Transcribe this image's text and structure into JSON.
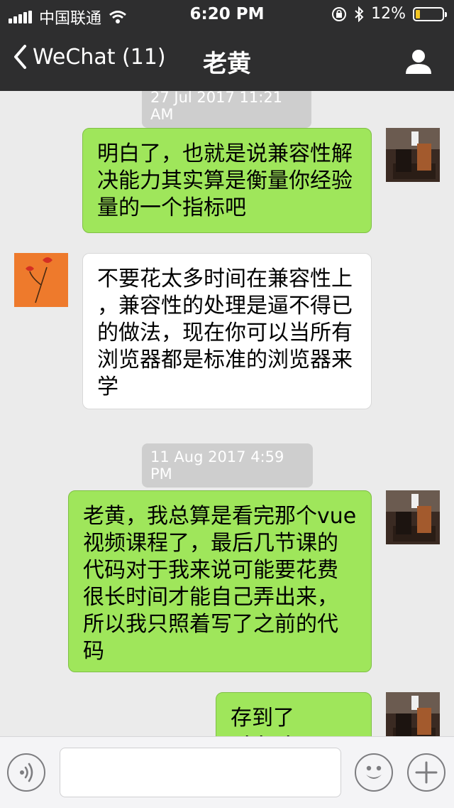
{
  "status_bar": {
    "carrier": "中国联通",
    "time": "6:20 PM",
    "battery_percent": "12%",
    "icons": [
      "signal-icon",
      "wifi-icon",
      "orientation-lock-icon",
      "bluetooth-icon",
      "battery-icon"
    ]
  },
  "nav": {
    "back_label": "WeChat (11)",
    "title": "老黄",
    "icons": [
      "chevron-left-icon",
      "profile-icon"
    ]
  },
  "chat": {
    "timestamps": [
      "27 Jul 2017 11:21 AM",
      "11 Aug 2017 4:59 PM"
    ],
    "messages": [
      {
        "sender": "me",
        "lines": [
          "明白了，也就是说兼容性解",
          "决能力其实算是衡量你经验",
          "量的一个指标吧"
        ]
      },
      {
        "sender": "other",
        "lines": [
          "不要花太多时间在兼容性上",
          "，兼容性的处理是逼不得已",
          "的做法，现在你可以当所有",
          "浏览器都是标准的浏览器来",
          "学"
        ]
      },
      {
        "sender": "me",
        "lines": [
          "老黄，我总算是看完那个vue",
          "视频课程了，最后几节课的",
          "代码对于我来说可能要花费",
          "很长时间才能自己弄出来，",
          "所以我只照着写了之前的代",
          "码"
        ]
      },
      {
        "sender": "me",
        "lines": [
          "存到了github"
        ]
      }
    ]
  },
  "input_bar": {
    "input_value": "",
    "icons": [
      "voice-icon",
      "emoji-icon",
      "plus-icon"
    ]
  },
  "colors": {
    "header_bg": "#2e2e2f",
    "chat_bg": "#ebebeb",
    "my_bubble": "#9fe65b",
    "other_bubble": "#ffffff",
    "battery_low": "#f3c623"
  }
}
